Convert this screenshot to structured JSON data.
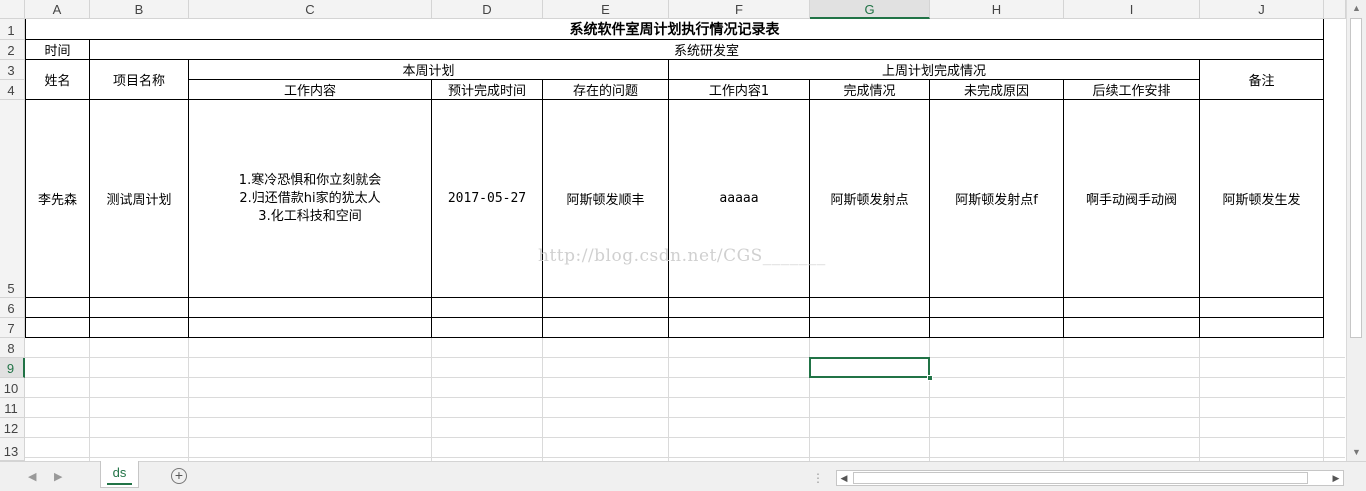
{
  "columns": [
    "A",
    "B",
    "C",
    "D",
    "E",
    "F",
    "G",
    "H",
    "I",
    "J"
  ],
  "rows": [
    "1",
    "2",
    "3",
    "4",
    "5",
    "6",
    "7",
    "8",
    "9",
    "10",
    "11",
    "12",
    "13"
  ],
  "selected_column": "G",
  "selected_row": "9",
  "table": {
    "title": "系统软件室周计划执行情况记录表",
    "time_label": "时间",
    "time_value": "系统研发室",
    "header": {
      "name": "姓名",
      "project": "项目名称",
      "this_week": "本周计划",
      "last_week": "上周计划完成情况",
      "remarks": "备注",
      "work_content": "工作内容",
      "planned_finish": "预计完成时间",
      "issues": "存在的问题",
      "work_content1": "工作内容1",
      "completion": "完成情况",
      "unfinished_reason": "未完成原因",
      "follow_up": "后续工作安排"
    },
    "record": {
      "name": "李先森",
      "project": "测试周计划",
      "work_lines": [
        "1.寒冷恐惧和你立刻就会",
        "2.归还借款hi家的犹太人",
        "3.化工科技和空间"
      ],
      "planned_finish": "2017-05-27",
      "issues": "阿斯顿发顺丰",
      "work_content1": "aaaaa",
      "completion": "阿斯顿发射点",
      "unfinished_reason": "阿斯顿发射点f",
      "follow_up": "啊手动阀手动阀",
      "remarks": "阿斯顿发生发"
    }
  },
  "watermark": "http://blog.csdn.net/CGS_______",
  "sheet_tabs": [
    "ds"
  ],
  "icons": {
    "add_sheet": "plus-circle-icon",
    "nav_prev": "triangle-left-icon",
    "nav_next": "triangle-right-icon"
  },
  "colors": {
    "accent": "#217346",
    "header_bg": "#f3f3f3",
    "gridline": "#dadada"
  }
}
